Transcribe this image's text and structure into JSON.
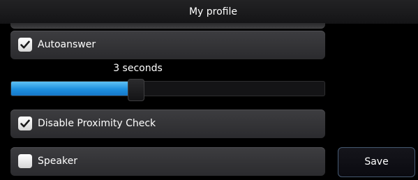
{
  "window": {
    "title": "My profile"
  },
  "settings": {
    "autoanswer": {
      "label": "Autoanswer",
      "checked": true
    },
    "autoanswer_delay": {
      "value_text": "3 seconds",
      "level": 0.4
    },
    "disable_proximity_check": {
      "label": "Disable Proximity Check",
      "checked": true
    },
    "speaker": {
      "label": "Speaker",
      "checked": false
    }
  },
  "actions": {
    "save_label": "Save"
  },
  "icons": {
    "checkbox_checked": "checkmark-icon"
  },
  "colors": {
    "background": "#000000",
    "slider_fill": "#1d8fdf",
    "save_border": "#465a72"
  }
}
